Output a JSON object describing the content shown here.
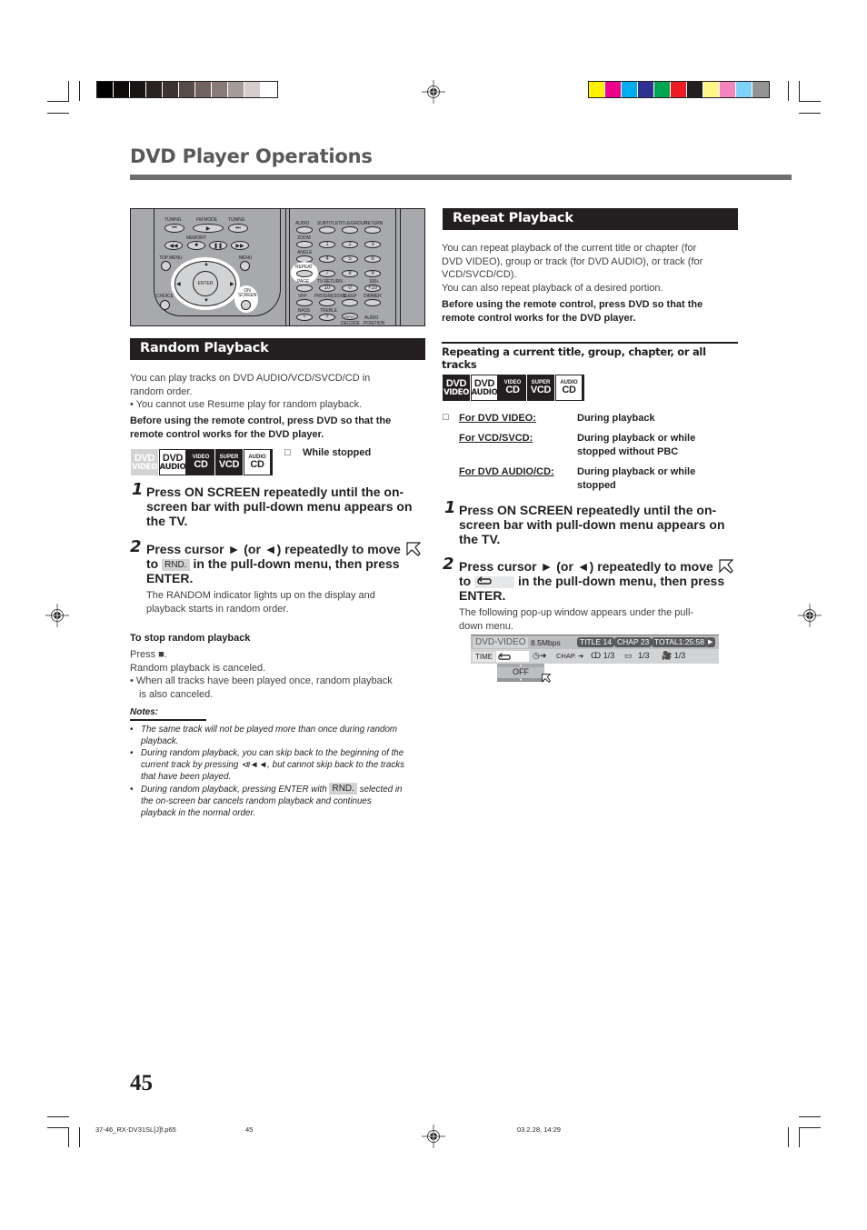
{
  "page": {
    "title": "DVD Player Operations",
    "page_number": "45"
  },
  "print_marks": {
    "grayscale_bar": [
      "#000000",
      "#0e0b0a",
      "#1a1414",
      "#2a2220",
      "#3c3231",
      "#564b48",
      "#6f6360",
      "#877b78",
      "#a59c99",
      "#d6cdcc",
      "#ffffff"
    ],
    "color_bar": [
      "#fff200",
      "#ec008c",
      "#00aeef",
      "#2e3192",
      "#00a651",
      "#ed1c24",
      "#231f20",
      "#fff685",
      "#f383c1",
      "#7dd3f7",
      "#939393"
    ],
    "footer_file": "37-46_RX-DV31SL[J]f.p65",
    "footer_page": "45",
    "footer_date": "03.2.28, 14:29"
  },
  "remote": {
    "left_labels": [
      "TUNING",
      "FM MODE",
      "TUNING",
      "MEMORY",
      "TOP MENU",
      "MENU",
      "ENTER",
      "CHOICE",
      "ON SCREEN"
    ],
    "right_labels": [
      "AUDIO",
      "SUBTITLE",
      "TITLE/GROUP",
      "RETURN",
      "ZOOM",
      "ANGLE",
      "REPEAT",
      "PAGE",
      "TV RETURN",
      "100+",
      "VFP",
      "PROGRESSIVE",
      "SLEEP",
      "DIMMER",
      "BASS",
      "TREBLE",
      "INPUT DECODE",
      "AUDIO POSITION"
    ],
    "number_keys": [
      "1",
      "2",
      "3",
      "4",
      "5",
      "6",
      "7",
      "8",
      "9",
      "10",
      "0",
      "+10"
    ]
  },
  "random": {
    "header": "Random Playback",
    "intro_line1": "You can play tracks on DVD AUDIO/VCD/SVCD/CD in",
    "intro_line2": "random order.",
    "bullet1": "• You cannot use Resume play for random playback.",
    "before_line1": "Before using the remote control, press DVD so that the",
    "before_line2": "remote control works for the DVD player.",
    "discs": [
      {
        "top": "DVD",
        "bottom": "VIDEO",
        "style": "grey"
      },
      {
        "top": "DVD",
        "bottom": "AUDIO",
        "style": "white"
      },
      {
        "top": "VIDEO",
        "bottom": "CD",
        "style": "black"
      },
      {
        "top": "SUPER",
        "bottom": "VCD",
        "style": "black"
      },
      {
        "top": "AUDIO",
        "bottom": "CD",
        "style": "white"
      }
    ],
    "condition_box": "□",
    "condition": "While stopped",
    "step1_num": "1",
    "step1_line1": "Press ON SCREEN repeatedly until the on-",
    "step1_line2": "screen bar with pull-down menu appears on",
    "step1_line3": "the TV.",
    "step2_num": "2",
    "step2_line1": "Press cursor ► (or ◄) repeatedly to move",
    "step2_line2a": "to",
    "step2_chip": "RND.",
    "step2_line2b": "in the pull-down menu, then press",
    "step2_line3": "ENTER.",
    "step2_desc1": "The RANDOM indicator lights up on the display and",
    "step2_desc2": "playback starts in random order.",
    "stop_heading": "To stop random playback",
    "stop_press": "Press ■.",
    "stop_canceled": "Random playback is canceled.",
    "stop_bullet1": "• When all tracks have been played once, random playback",
    "stop_bullet2": "is also canceled.",
    "notes_heading": "Notes:",
    "notes": [
      {
        "l1": "The same track will not be played more than once during random",
        "l2": "playback.",
        "l3": ""
      },
      {
        "l1": "During random playback, you can skip back to the beginning of the",
        "l2": "current track by pressing ⧏◄◄, but cannot skip back to the tracks",
        "l3": "that have been played."
      },
      {
        "l1a": "During random playback, pressing ENTER with",
        "chip": "RND.",
        "l1b": "selected in",
        "l2": "the on-screen bar cancels random playback and continues",
        "l3": "playback in the normal order."
      }
    ]
  },
  "repeat": {
    "header": "Repeat Playback",
    "intro1": "You can repeat playback of the current title or chapter (for",
    "intro2": "DVD VIDEO), group or track (for DVD AUDIO), or track (for",
    "intro3": "VCD/SVCD/CD).",
    "intro4": "You can also repeat playback of a desired portion.",
    "before_line1": "Before using the remote control, press DVD so that the",
    "before_line2": "remote control works for the DVD player.",
    "sub_heading1": "Repeating a current title, group, chapter, or all",
    "sub_heading2": "tracks",
    "discs": [
      {
        "top": "DVD",
        "bottom": "VIDEO",
        "style": "black"
      },
      {
        "top": "DVD",
        "bottom": "AUDIO",
        "style": "white"
      },
      {
        "top": "VIDEO",
        "bottom": "CD",
        "style": "black"
      },
      {
        "top": "SUPER",
        "bottom": "VCD",
        "style": "black"
      },
      {
        "top": "AUDIO",
        "bottom": "CD",
        "style": "white"
      }
    ],
    "conditions": [
      {
        "label": "For DVD VIDEO:",
        "v1": "During playback",
        "v2": ""
      },
      {
        "label": "For VCD/SVCD:",
        "v1": "During playback or while",
        "v2": "stopped without PBC"
      },
      {
        "label": "For DVD AUDIO/CD:",
        "v1": "During playback or while",
        "v2": "stopped"
      }
    ],
    "condition_box": "□",
    "step1_num": "1",
    "step1_line1": "Press ON SCREEN repeatedly until the on-",
    "step1_line2": "screen bar with pull-down menu appears on",
    "step1_line3": "the TV.",
    "step2_num": "2",
    "step2_line1": "Press cursor ► (or ◄) repeatedly to move",
    "step2_line2a": "to",
    "step2_line2b": "in the pull-down menu, then press",
    "step2_line3": "ENTER.",
    "step2_desc1": "The following pop-up window appears under the pull-",
    "step2_desc2": "down menu."
  },
  "osd": {
    "source": "DVD-VIDEO",
    "bitrate": "8.5Mbps",
    "title": "TITLE 14",
    "chapter": "CHAP 23",
    "total": "TOTAL1:25:58",
    "time_label": "TIME",
    "chap_label": "CHAP.",
    "audio": "1/3",
    "subtitle": "1/3",
    "angle": "1/3",
    "dropdown_value": "OFF"
  }
}
